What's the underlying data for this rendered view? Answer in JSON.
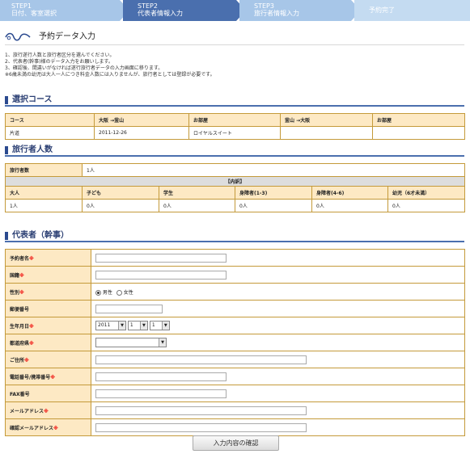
{
  "steps": [
    {
      "num": "STEP1",
      "label": "日付、客室選択",
      "color": "#a7c6e8"
    },
    {
      "num": "STEP2",
      "label": "代表者情報入力",
      "color": "#4a6fae"
    },
    {
      "num": "STEP3",
      "label": "旅行者情報入力",
      "color": "#a7c6e8"
    },
    {
      "num": "",
      "label": "予約完了",
      "color": "#c4dbf1"
    }
  ],
  "page_title": "予約データ入力",
  "notes": [
    "1、旅行遂行人数と旅行者区分を選んでください。",
    "2、代表者(幹事)様のデータ入力をお願いします。",
    "3、確認後、間違いがなければ遂行旅行者データの入力画面に移ります。",
    "※6歳未満の幼児は大人一人につき料金人数には入りませんが、旅行者としては登録が必要です。"
  ],
  "course": {
    "heading": "選択コース",
    "headers": [
      "コース",
      "大阪 →釜山",
      "お部屋",
      "釜山 →大阪",
      "お部屋"
    ],
    "row": [
      "片道",
      "2011-12-26",
      "ロイヤルスイート",
      "",
      ""
    ]
  },
  "travelers": {
    "heading": "旅行者人数",
    "total_label": "旅行者数",
    "total_value": "1人",
    "breakdown_label": "【内訳】",
    "headers": [
      "大人",
      "子ども",
      "学生",
      "身障者(1-3)",
      "身障者(4-6)",
      "幼児（6才未満）"
    ],
    "values": [
      "1人",
      "0人",
      "0人",
      "0人",
      "0人",
      "0人"
    ]
  },
  "rep": {
    "heading": "代表者（幹事）",
    "fields": {
      "name": "予約者名",
      "nationality": "国籍",
      "gender": "性別",
      "male": "男性",
      "female": "女性",
      "postal": "郵便番号",
      "birthday": "生年月日",
      "year": "2011",
      "month": "1",
      "day": "1",
      "prefecture": "都道府県",
      "address": "ご住所",
      "phone": "電話番号/携帯番号",
      "fax": "FAX番号",
      "email": "メールアドレス",
      "email_confirm": "確認メールアドレス"
    },
    "required_mark": "※"
  },
  "confirm_button": "入力内容の確認"
}
